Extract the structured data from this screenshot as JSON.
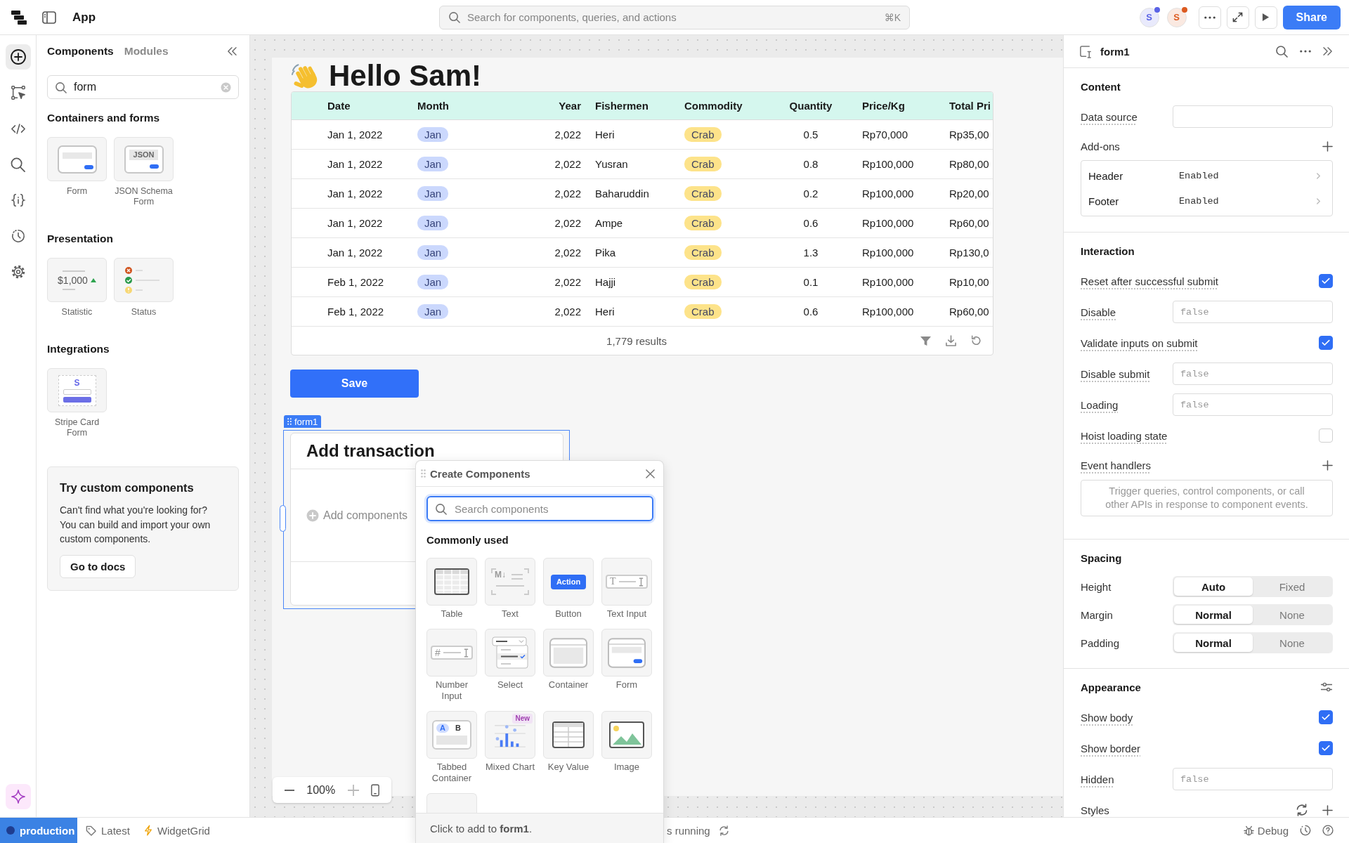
{
  "topbar": {
    "app_name": "App",
    "search": {
      "placeholder": "Search for components, queries, and actions",
      "shortcut": "⌘K"
    },
    "avatars": [
      {
        "initial": "S",
        "color": "#5a63e6"
      },
      {
        "initial": "S",
        "color": "#dc5a20"
      }
    ],
    "share_button": "Share"
  },
  "rail": {
    "items": [
      {
        "kind": "add",
        "selected": true
      },
      {
        "kind": "workflow",
        "selected": false
      },
      {
        "kind": "code",
        "selected": false
      },
      {
        "kind": "search",
        "selected": false
      },
      {
        "kind": "state",
        "selected": false
      },
      {
        "kind": "history",
        "selected": false
      },
      {
        "kind": "settings",
        "selected": false
      }
    ],
    "bottom_items": [
      {
        "kind": "assistant"
      }
    ]
  },
  "components_panel": {
    "tabs": [
      {
        "label": "Components",
        "selected": true
      },
      {
        "label": "Modules",
        "selected": false
      }
    ],
    "search": {
      "value": "form"
    },
    "sections": [
      {
        "title": "Containers and forms",
        "items": [
          {
            "label": "Form",
            "kind": "form"
          },
          {
            "label": "JSON Schema Form",
            "kind": "json_schema_form",
            "tile_text": "JSON"
          }
        ]
      },
      {
        "title": "Presentation",
        "items": [
          {
            "label": "Statistic",
            "kind": "statistic",
            "tile_text": "$1,000"
          },
          {
            "label": "Status",
            "kind": "status"
          }
        ]
      },
      {
        "title": "Integrations",
        "items": [
          {
            "label": "Stripe Card Form",
            "kind": "stripe_card_form",
            "tile_text": "S"
          }
        ]
      }
    ],
    "promo": {
      "title": "Try custom components",
      "text": "Can't find what you're looking for? You can build and import your own custom components.",
      "button": "Go to docs"
    }
  },
  "canvas": {
    "heading": "Hello Sam!",
    "table": {
      "columns": [
        {
          "label": "Date",
          "kind": "text"
        },
        {
          "label": "Month",
          "kind": "tag",
          "color": "#cbd8fd"
        },
        {
          "label": "Year",
          "kind": "number"
        },
        {
          "label": "Fishermen",
          "kind": "text"
        },
        {
          "label": "Commodity",
          "kind": "tag",
          "color": "#fde38a"
        },
        {
          "label": "Quantity",
          "kind": "decimal"
        },
        {
          "label": "Price/Kg",
          "kind": "text"
        },
        {
          "label": "Total Pri",
          "kind": "text"
        }
      ],
      "rows": [
        {
          "cells": [
            "Jan 1, 2022",
            "Jan",
            "2,022",
            "Heri",
            "Crab",
            "0.5",
            "Rp70,000",
            "Rp35,00"
          ]
        },
        {
          "cells": [
            "Jan 1, 2022",
            "Jan",
            "2,022",
            "Yusran",
            "Crab",
            "0.8",
            "Rp100,000",
            "Rp80,00"
          ]
        },
        {
          "cells": [
            "Jan 1, 2022",
            "Jan",
            "2,022",
            "Baharuddin",
            "Crab",
            "0.2",
            "Rp100,000",
            "Rp20,00"
          ]
        },
        {
          "cells": [
            "Jan 1, 2022",
            "Jan",
            "2,022",
            "Ampe",
            "Crab",
            "0.6",
            "Rp100,000",
            "Rp60,00"
          ]
        },
        {
          "cells": [
            "Jan 1, 2022",
            "Jan",
            "2,022",
            "Pika",
            "Crab",
            "1.3",
            "Rp100,000",
            "Rp130,0"
          ]
        },
        {
          "cells": [
            "Feb 1, 2022",
            "Jan",
            "2,022",
            "Hajji",
            "Crab",
            "0.1",
            "Rp100,000",
            "Rp10,00"
          ]
        },
        {
          "cells": [
            "Feb 1, 2022",
            "Jan",
            "2,022",
            "Heri",
            "Crab",
            "0.6",
            "Rp100,000",
            "Rp60,00"
          ]
        }
      ],
      "footer": "1,779 results"
    },
    "save_button": "Save",
    "form": {
      "tag": "form1",
      "title": "Add transaction",
      "add_hint": "Add components"
    },
    "zoom": "100%"
  },
  "popup": {
    "title": "Create Components",
    "search": {
      "placeholder": "Search components"
    },
    "section": "Commonly used",
    "items": [
      {
        "label": "Table",
        "kind": "table"
      },
      {
        "label": "Text",
        "kind": "text",
        "tile_text": "M↓"
      },
      {
        "label": "Button",
        "kind": "button",
        "tile_text": "Action"
      },
      {
        "label": "Text Input",
        "kind": "text_input",
        "tile_text": "T"
      },
      {
        "label": "Number Input",
        "kind": "number_input",
        "tile_text": "#"
      },
      {
        "label": "Select",
        "kind": "select"
      },
      {
        "label": "Container",
        "kind": "container"
      },
      {
        "label": "Form",
        "kind": "form"
      },
      {
        "label": "Tabbed Container",
        "kind": "tabbed_container",
        "tabs": [
          {
            "label": "A",
            "selected": true
          },
          {
            "label": "B",
            "selected": false
          }
        ]
      },
      {
        "label": "Mixed Chart",
        "kind": "mixed_chart",
        "badge": "New"
      },
      {
        "label": "Key Value",
        "kind": "key_value"
      },
      {
        "label": "Image",
        "kind": "image"
      },
      {
        "kind": "cut_off"
      }
    ],
    "hint": "Click to add to **form1**."
  },
  "inspector": {
    "title": "form1",
    "sections": [
      {
        "title": "Content",
        "rows": [
          {
            "kind": "input",
            "label": "Data source"
          },
          {
            "kind": "add",
            "label": "Add-ons",
            "items": [
              {
                "name": "Header",
                "value": "Enabled"
              },
              {
                "name": "Footer",
                "value": "Enabled"
              }
            ]
          }
        ]
      },
      {
        "title": "Interaction",
        "rows": [
          {
            "kind": "checkbox",
            "label": "Reset after successful submit",
            "checked": true
          },
          {
            "kind": "input",
            "label": "Disable",
            "placeholder": "false"
          },
          {
            "kind": "checkbox",
            "label": "Validate inputs on submit",
            "checked": true
          },
          {
            "kind": "input",
            "label": "Disable submit",
            "placeholder": "false"
          },
          {
            "kind": "input",
            "label": "Loading",
            "placeholder": "false"
          },
          {
            "kind": "checkbox",
            "label": "Hoist loading state",
            "checked": false
          },
          {
            "kind": "add",
            "label": "Event handlers",
            "note": "Trigger queries, control components, or call other APIs in response to component events."
          }
        ]
      },
      {
        "title": "Spacing",
        "rows": [
          {
            "kind": "segmented",
            "label": "Height",
            "options": [
              {
                "label": "Auto",
                "selected": true
              },
              {
                "label": "Fixed",
                "selected": false
              }
            ]
          },
          {
            "kind": "segmented",
            "label": "Margin",
            "options": [
              {
                "label": "Normal",
                "selected": true
              },
              {
                "label": "None",
                "selected": false
              }
            ]
          },
          {
            "kind": "segmented",
            "label": "Padding",
            "options": [
              {
                "label": "Normal",
                "selected": true
              },
              {
                "label": "None",
                "selected": false
              }
            ]
          }
        ]
      },
      {
        "title": "Appearance",
        "settings_button": true,
        "rows": [
          {
            "kind": "checkbox",
            "label": "Show body",
            "checked": true
          },
          {
            "kind": "checkbox",
            "label": "Show border",
            "checked": true
          },
          {
            "kind": "input",
            "label": "Hidden",
            "placeholder": "false"
          },
          {
            "kind": "styles",
            "label": "Styles"
          }
        ]
      }
    ]
  },
  "status_bar": {
    "environment": "production",
    "release": "Latest",
    "grid": "WidgetGrid",
    "status": "s running",
    "debug": "Debug"
  }
}
